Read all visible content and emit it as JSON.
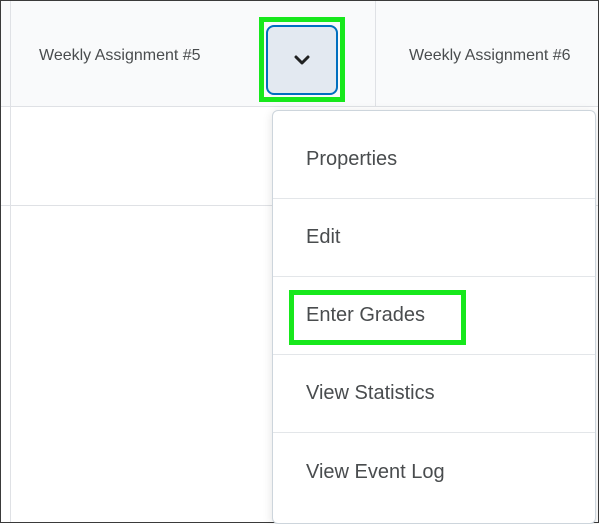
{
  "header": {
    "columns": [
      {
        "label": "Weekly Assignment #5"
      },
      {
        "label": "Weekly Assignment #6"
      }
    ]
  },
  "column_menu": {
    "button_icon": "chevron-down-icon",
    "items": [
      {
        "label": "Properties"
      },
      {
        "label": "Edit"
      },
      {
        "label": "Enter Grades"
      },
      {
        "label": "View Statistics"
      },
      {
        "label": "View Event Log"
      }
    ]
  },
  "colors": {
    "highlight": "#17e81c",
    "button_bg": "#e3e9f1",
    "button_border": "#006fbf",
    "text": "#494c4e"
  }
}
